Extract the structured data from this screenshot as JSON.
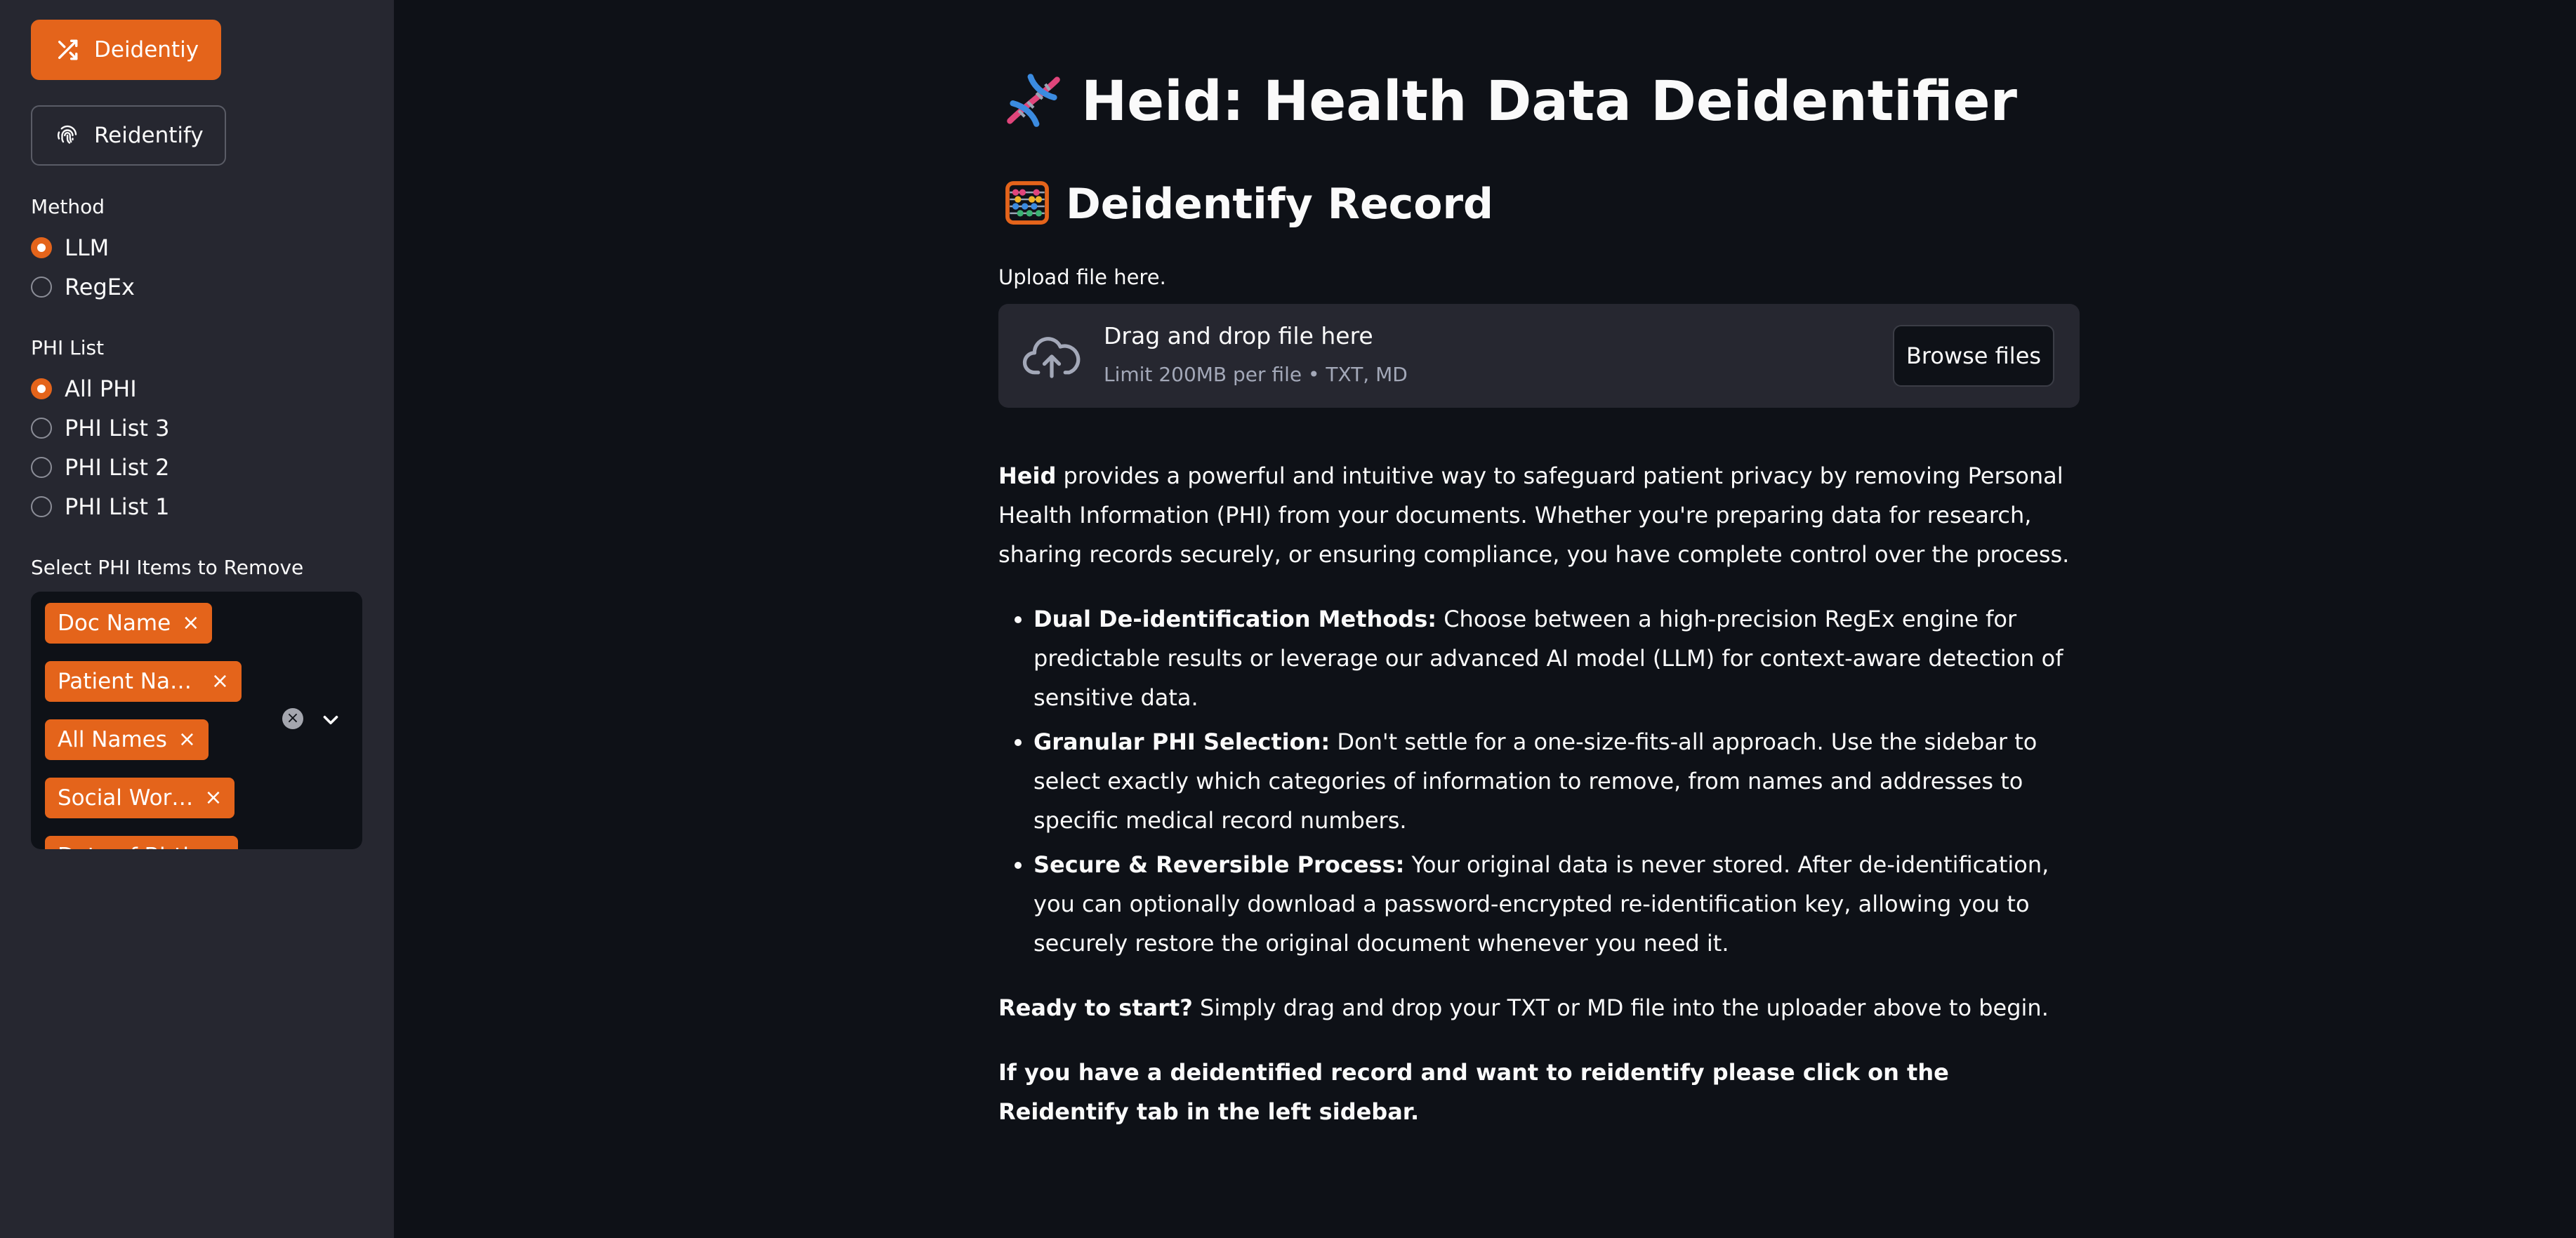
{
  "sidebar": {
    "deidentify_button": "Deidentiy",
    "reidentify_button": "Reidentify",
    "method": {
      "label": "Method",
      "options": [
        "LLM",
        "RegEx"
      ],
      "selected": "LLM"
    },
    "phi_list": {
      "label": "PHI List",
      "options": [
        "All PHI",
        "PHI List 3",
        "PHI List 2",
        "PHI List 1"
      ],
      "selected": "All PHI"
    },
    "phi_items": {
      "label": "Select PHI Items to Remove",
      "tags": [
        "Doc Name",
        "Patient Name",
        "All Names",
        "Social Wor…",
        "Date of Birth"
      ]
    }
  },
  "main": {
    "title": "Heid: Health Data Deidentifier",
    "subtitle": "Deidentify Record",
    "upload_label": "Upload file here.",
    "dropzone": {
      "main_text": "Drag and drop file here",
      "sub_text": "Limit 200MB per file • TXT, MD",
      "browse_label": "Browse files"
    },
    "intro": {
      "bold": "Heid",
      "text": " provides a powerful and intuitive way to safeguard patient privacy by removing Personal Health Information (PHI) from your documents. Whether you're preparing data for research, sharing records securely, or ensuring compliance, you have complete control over the process."
    },
    "features": [
      {
        "title": "Dual De-identification Methods:",
        "text": " Choose between a high-precision RegEx engine for predictable results or leverage our advanced AI model (LLM) for context-aware detection of sensitive data."
      },
      {
        "title": "Granular PHI Selection:",
        "text": " Don't settle for a one-size-fits-all approach. Use the sidebar to select exactly which categories of information to remove, from names and addresses to specific medical record numbers."
      },
      {
        "title": "Secure & Reversible Process:",
        "text": " Your original data is never stored. After de-identification, you can optionally download a password-encrypted re-identification key, allowing you to securely restore the original document whenever you need it."
      }
    ],
    "ready": {
      "bold": "Ready to start?",
      "text": " Simply drag and drop your TXT or MD file into the uploader above to begin."
    },
    "reidentify_note": "If you have a deidentified record and want to reidentify please click on the Reidentify tab in the left sidebar."
  },
  "colors": {
    "accent": "#e4641b",
    "background": "#0e1117",
    "sidebar": "#262730"
  }
}
